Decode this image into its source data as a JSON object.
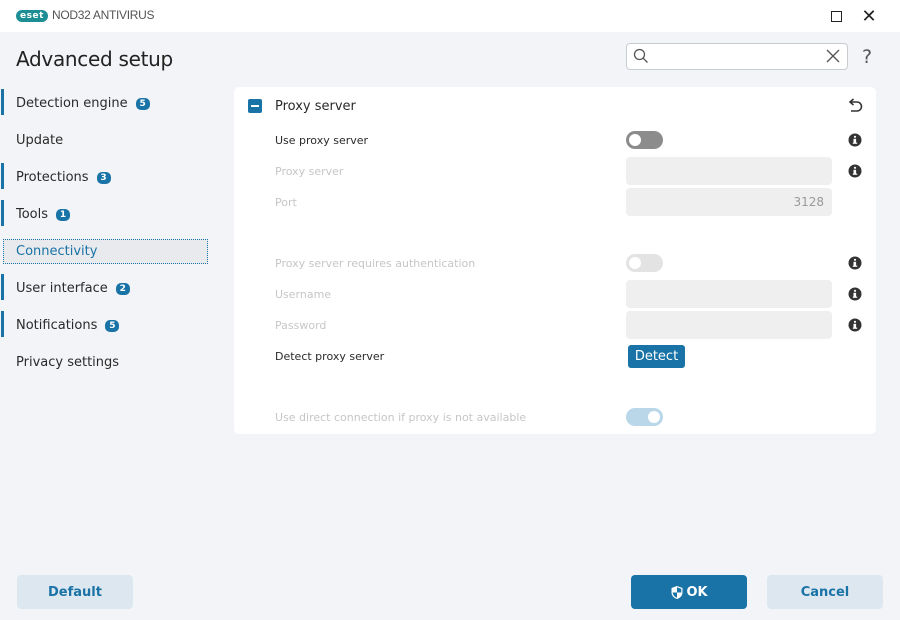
{
  "titlebar": {
    "logo": "eset",
    "app_name": "NOD32 ANTIVIRUS",
    "maximize_icon": "maximize-icon",
    "close_icon": "close-icon"
  },
  "header": {
    "title": "Advanced setup",
    "search": {
      "value": "",
      "placeholder": ""
    },
    "help_label": "?"
  },
  "sidebar": {
    "items": [
      {
        "label": "Detection engine",
        "badge": "5",
        "marked": true,
        "selected": false
      },
      {
        "label": "Update",
        "badge": null,
        "marked": false,
        "selected": false
      },
      {
        "label": "Protections",
        "badge": "3",
        "marked": true,
        "selected": false
      },
      {
        "label": "Tools",
        "badge": "1",
        "marked": true,
        "selected": false
      },
      {
        "label": "Connectivity",
        "badge": null,
        "marked": false,
        "selected": true
      },
      {
        "label": "User interface",
        "badge": "2",
        "marked": true,
        "selected": false
      },
      {
        "label": "Notifications",
        "badge": "5",
        "marked": true,
        "selected": false
      },
      {
        "label": "Privacy settings",
        "badge": null,
        "marked": false,
        "selected": false
      }
    ]
  },
  "panel": {
    "section_title": "Proxy server",
    "rows": {
      "use_proxy": {
        "label": "Use proxy server",
        "state": "off",
        "enabled": true
      },
      "proxy_server": {
        "label": "Proxy server",
        "value": "",
        "enabled": false
      },
      "port": {
        "label": "Port",
        "value": "3128",
        "enabled": false
      },
      "requires_auth": {
        "label": "Proxy server requires authentication",
        "state": "off",
        "enabled": false
      },
      "username": {
        "label": "Username",
        "value": "",
        "enabled": false
      },
      "password": {
        "label": "Password",
        "value": "",
        "enabled": false
      },
      "detect": {
        "label": "Detect proxy server",
        "button_label": "Detect",
        "enabled": true
      },
      "direct_connection": {
        "label": "Use direct connection if proxy is not available",
        "state": "on",
        "enabled": false
      }
    }
  },
  "footer": {
    "default_label": "Default",
    "ok_label": "OK",
    "cancel_label": "Cancel"
  },
  "colors": {
    "accent": "#1a73a6",
    "logo": "#1d8f94",
    "background": "#f2f4f7"
  }
}
